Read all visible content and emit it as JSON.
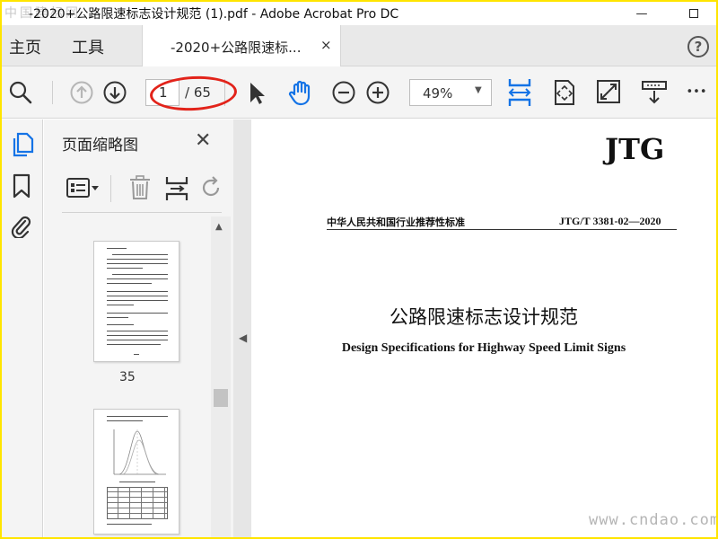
{
  "window": {
    "title": "-2020+公路限速标志设计规范 (1).pdf - Adobe Acrobat Pro DC",
    "watermark": "中国建标网",
    "minimize_label": "—"
  },
  "tabs": {
    "home_label": "主页",
    "tools_label": "工具",
    "doc_tab_label": "-2020+公路限速标...",
    "close_glyph": "×",
    "help_glyph": "?"
  },
  "toolbar": {
    "current_page": "1",
    "total_pages": "/ 65",
    "zoom": "49%",
    "caret": "▼",
    "more": "•••"
  },
  "thumbnail_panel": {
    "title": "页面缩略图",
    "close_glyph": "✕",
    "page_label": "35",
    "scroll_up": "▲"
  },
  "collapse_arrow": "◀",
  "document": {
    "logo": "JTG",
    "category": "中华人民共和国行业推荐性标准",
    "standard_number": "JTG/T 3381-02—2020",
    "title_cn": "公路限速标志设计规范",
    "title_en": "Design Specifications for Highway Speed Limit Signs"
  },
  "site_watermark": "www.cndao.com",
  "colors": {
    "frame": "#ffe500",
    "accent_blue": "#1473e6",
    "annotation_red": "#e2231a"
  }
}
